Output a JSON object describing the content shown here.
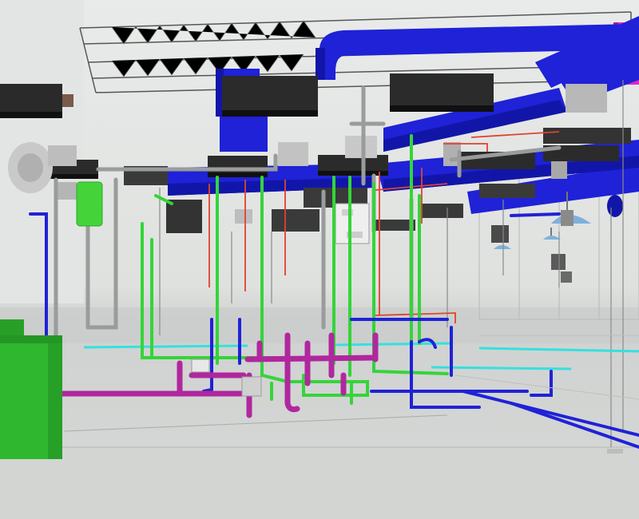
{
  "scene": {
    "label": "",
    "colors": {
      "supply_duct": "#1f22d6",
      "supply_duct_dark": "#1216a8",
      "domestic_water": "#35d43a",
      "waste_pipe": "#b0279e",
      "hydronic_red": "#e0422f",
      "fire_cyan": "#34e0e0",
      "gray_pipe": "#9a9c9c",
      "diffuser_dark": "#2a2a2a",
      "equipment_green": "#2fb82f",
      "ceiling_truss": "#505050",
      "pink_duct": "#d62ac8"
    },
    "icons": [
      "water-heater-icon",
      "air-handler-icon"
    ],
    "visible_text": ""
  }
}
